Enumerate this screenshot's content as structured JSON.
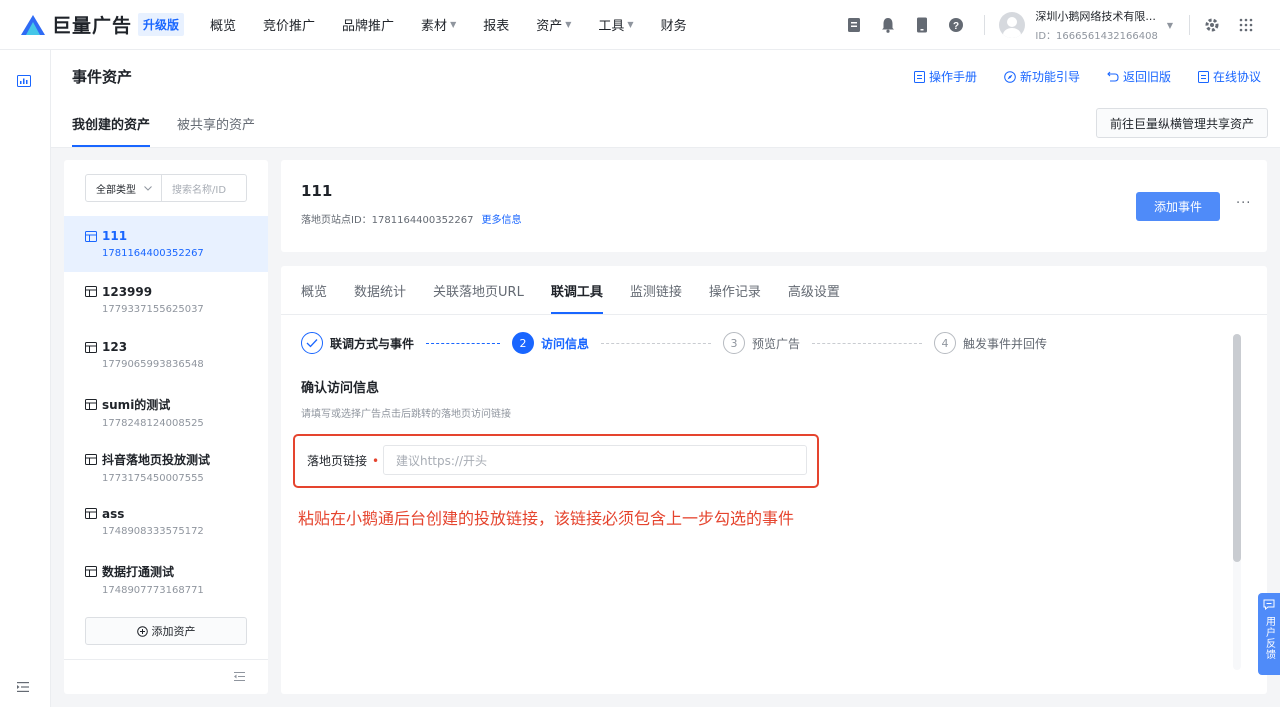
{
  "brand": {
    "name": "巨量广告",
    "badge": "升级版"
  },
  "nav": {
    "items": [
      {
        "label": "概览",
        "caret": false
      },
      {
        "label": "竞价推广",
        "caret": false
      },
      {
        "label": "品牌推广",
        "caret": false
      },
      {
        "label": "素材",
        "caret": true
      },
      {
        "label": "报表",
        "caret": false
      },
      {
        "label": "资产",
        "caret": true
      },
      {
        "label": "工具",
        "caret": true
      },
      {
        "label": "财务",
        "caret": false
      }
    ]
  },
  "account": {
    "name": "深圳小鹅网络技术有限...",
    "id": "ID：1666561432166408"
  },
  "page": {
    "title": "事件资产",
    "links": [
      "操作手册",
      "新功能引导",
      "返回旧版",
      "在线协议"
    ],
    "subtabs": [
      "我创建的资产",
      "被共享的资产"
    ],
    "share_button": "前往巨量纵横管理共享资产"
  },
  "sidebar": {
    "filter_type": "全部类型",
    "search_placeholder": "搜索名称/ID",
    "assets": [
      {
        "name": "111",
        "id": "1781164400352267",
        "active": true
      },
      {
        "name": "123999",
        "id": "1779337155625037",
        "active": false
      },
      {
        "name": "123",
        "id": "1779065993836548",
        "active": false
      },
      {
        "name": "sumi的测试",
        "id": "1778248124008525",
        "active": false
      },
      {
        "name": "抖音落地页投放测试",
        "id": "1773175450007555",
        "active": false
      },
      {
        "name": "ass",
        "id": "1748908333575172",
        "active": false
      },
      {
        "name": "数据打通测试",
        "id": "1748907773168771",
        "active": false
      }
    ],
    "add_button": "添加资产"
  },
  "asset_detail": {
    "title": "111",
    "site_id_label": "落地页站点ID：1781164400352267",
    "more_info": "更多信息",
    "add_event_button": "添加事件",
    "more_menu": "···"
  },
  "tabs": [
    "概览",
    "数据统计",
    "关联落地页URL",
    "联调工具",
    "监测链接",
    "操作记录",
    "高级设置"
  ],
  "active_tab": "联调工具",
  "steps": [
    {
      "num": "✓",
      "label": "联调方式与事件",
      "state": "done"
    },
    {
      "num": "2",
      "label": "访问信息",
      "state": "active"
    },
    {
      "num": "3",
      "label": "预览广告",
      "state": "todo"
    },
    {
      "num": "4",
      "label": "触发事件并回传",
      "state": "todo"
    }
  ],
  "section": {
    "title": "确认访问信息",
    "desc": "请填写或选择广告点击后跳转的落地页访问链接",
    "field_label": "落地页链接",
    "required_mark": "•",
    "input_placeholder": "建议https://开头",
    "annotation": "粘贴在小鹅通后台创建的投放链接，该链接必须包含上一步勾选的事件"
  },
  "feedback": {
    "label": "用户反馈"
  },
  "colors": {
    "accent": "#1966ff",
    "button": "#4f8bf9",
    "highlight": "#e5442e"
  }
}
